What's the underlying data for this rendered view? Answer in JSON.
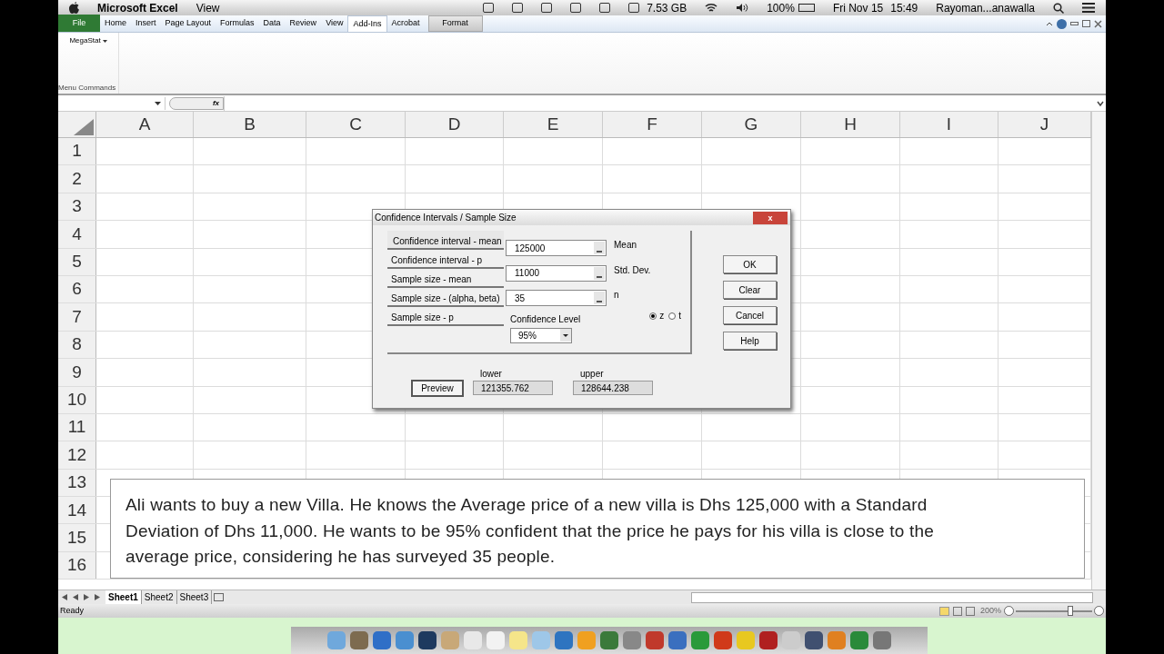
{
  "menubar": {
    "app": "Microsoft Excel",
    "menus": [
      "View"
    ],
    "status": [
      "7.53 GB",
      "100%",
      "Fri Nov 15",
      "15:49",
      "Rayoman...anawalla"
    ]
  },
  "ribbon": {
    "file_tab": "File",
    "tabs": [
      {
        "label": "Home",
        "selected": false
      },
      {
        "label": "Insert",
        "selected": false
      },
      {
        "label": "Page Layout",
        "selected": false
      },
      {
        "label": "Formulas",
        "selected": false
      },
      {
        "label": "Data",
        "selected": false
      },
      {
        "label": "Review",
        "selected": false
      },
      {
        "label": "View",
        "selected": false
      },
      {
        "label": "Add-Ins",
        "selected": true
      },
      {
        "label": "Acrobat",
        "selected": false
      }
    ],
    "contextual_tab": "Format",
    "menu_button": "MegaStat",
    "group_label": "Menu Commands"
  },
  "sheet": {
    "columns": [
      "A",
      "B",
      "C",
      "D",
      "E",
      "F",
      "G",
      "H",
      "I",
      "J"
    ],
    "rows": [
      "1",
      "2",
      "3",
      "4",
      "5",
      "6",
      "7",
      "8",
      "9",
      "10",
      "11",
      "12",
      "13",
      "14",
      "15",
      "16"
    ]
  },
  "note": "Ali wants to buy a new Villa. He knows the Average price of a new villa is Dhs 125,000 with a Standard Deviation of Dhs 11,000. He wants to be 95% confident that the price he pays for his villa is close to the average price, considering he has surveyed 35 people.",
  "dialog": {
    "title": "Confidence Intervals / Sample Size",
    "close": "x",
    "options": [
      {
        "label": "Confidence interval - mean",
        "selected": true
      },
      {
        "label": "Confidence interval - p",
        "selected": false
      },
      {
        "label": "Sample size - mean",
        "selected": false
      },
      {
        "label": "Sample size - (alpha, beta)",
        "selected": false
      },
      {
        "label": "Sample size - p",
        "selected": false
      }
    ],
    "fields": [
      {
        "value": "125000",
        "label": "Mean"
      },
      {
        "value": "11000",
        "label": "Std. Dev."
      },
      {
        "value": "35",
        "label": "n"
      }
    ],
    "confidence_label": "Confidence Level",
    "confidence_value": "95%",
    "distribution": [
      {
        "label": "z",
        "selected": true
      },
      {
        "label": "t",
        "selected": false
      }
    ],
    "buttons": [
      "OK",
      "Clear",
      "Cancel",
      "Help"
    ],
    "preview": "Preview",
    "lower_label": "lower",
    "lower": "121355.762",
    "upper_label": "upper",
    "upper": "128644.238"
  },
  "sheet_tabs": [
    {
      "label": "Sheet1",
      "selected": true
    },
    {
      "label": "Sheet2",
      "selected": false
    },
    {
      "label": "Sheet3",
      "selected": false
    }
  ],
  "status_bar": {
    "state": "Ready",
    "zoom": "200%",
    "zoom_slider": {
      "level": 0.72
    }
  },
  "formula_bar": {
    "function_label": "fx"
  }
}
